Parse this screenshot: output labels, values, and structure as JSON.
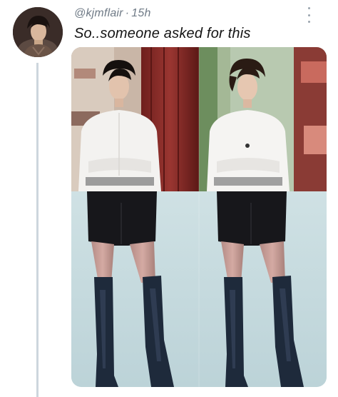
{
  "tweet": {
    "handle": "@kjmflair",
    "separator": "·",
    "time": "15h",
    "text": "So..someone asked for this",
    "more_icon": "more-vertical-icon"
  },
  "media": {
    "layout": "2x2 collage",
    "panels": [
      "top-left",
      "top-right",
      "bottom-left",
      "bottom-right"
    ]
  },
  "colors": {
    "handle": "#6f7a86",
    "text": "#141414",
    "thread_line": "#cdd6dd",
    "background": "#ffffff"
  }
}
